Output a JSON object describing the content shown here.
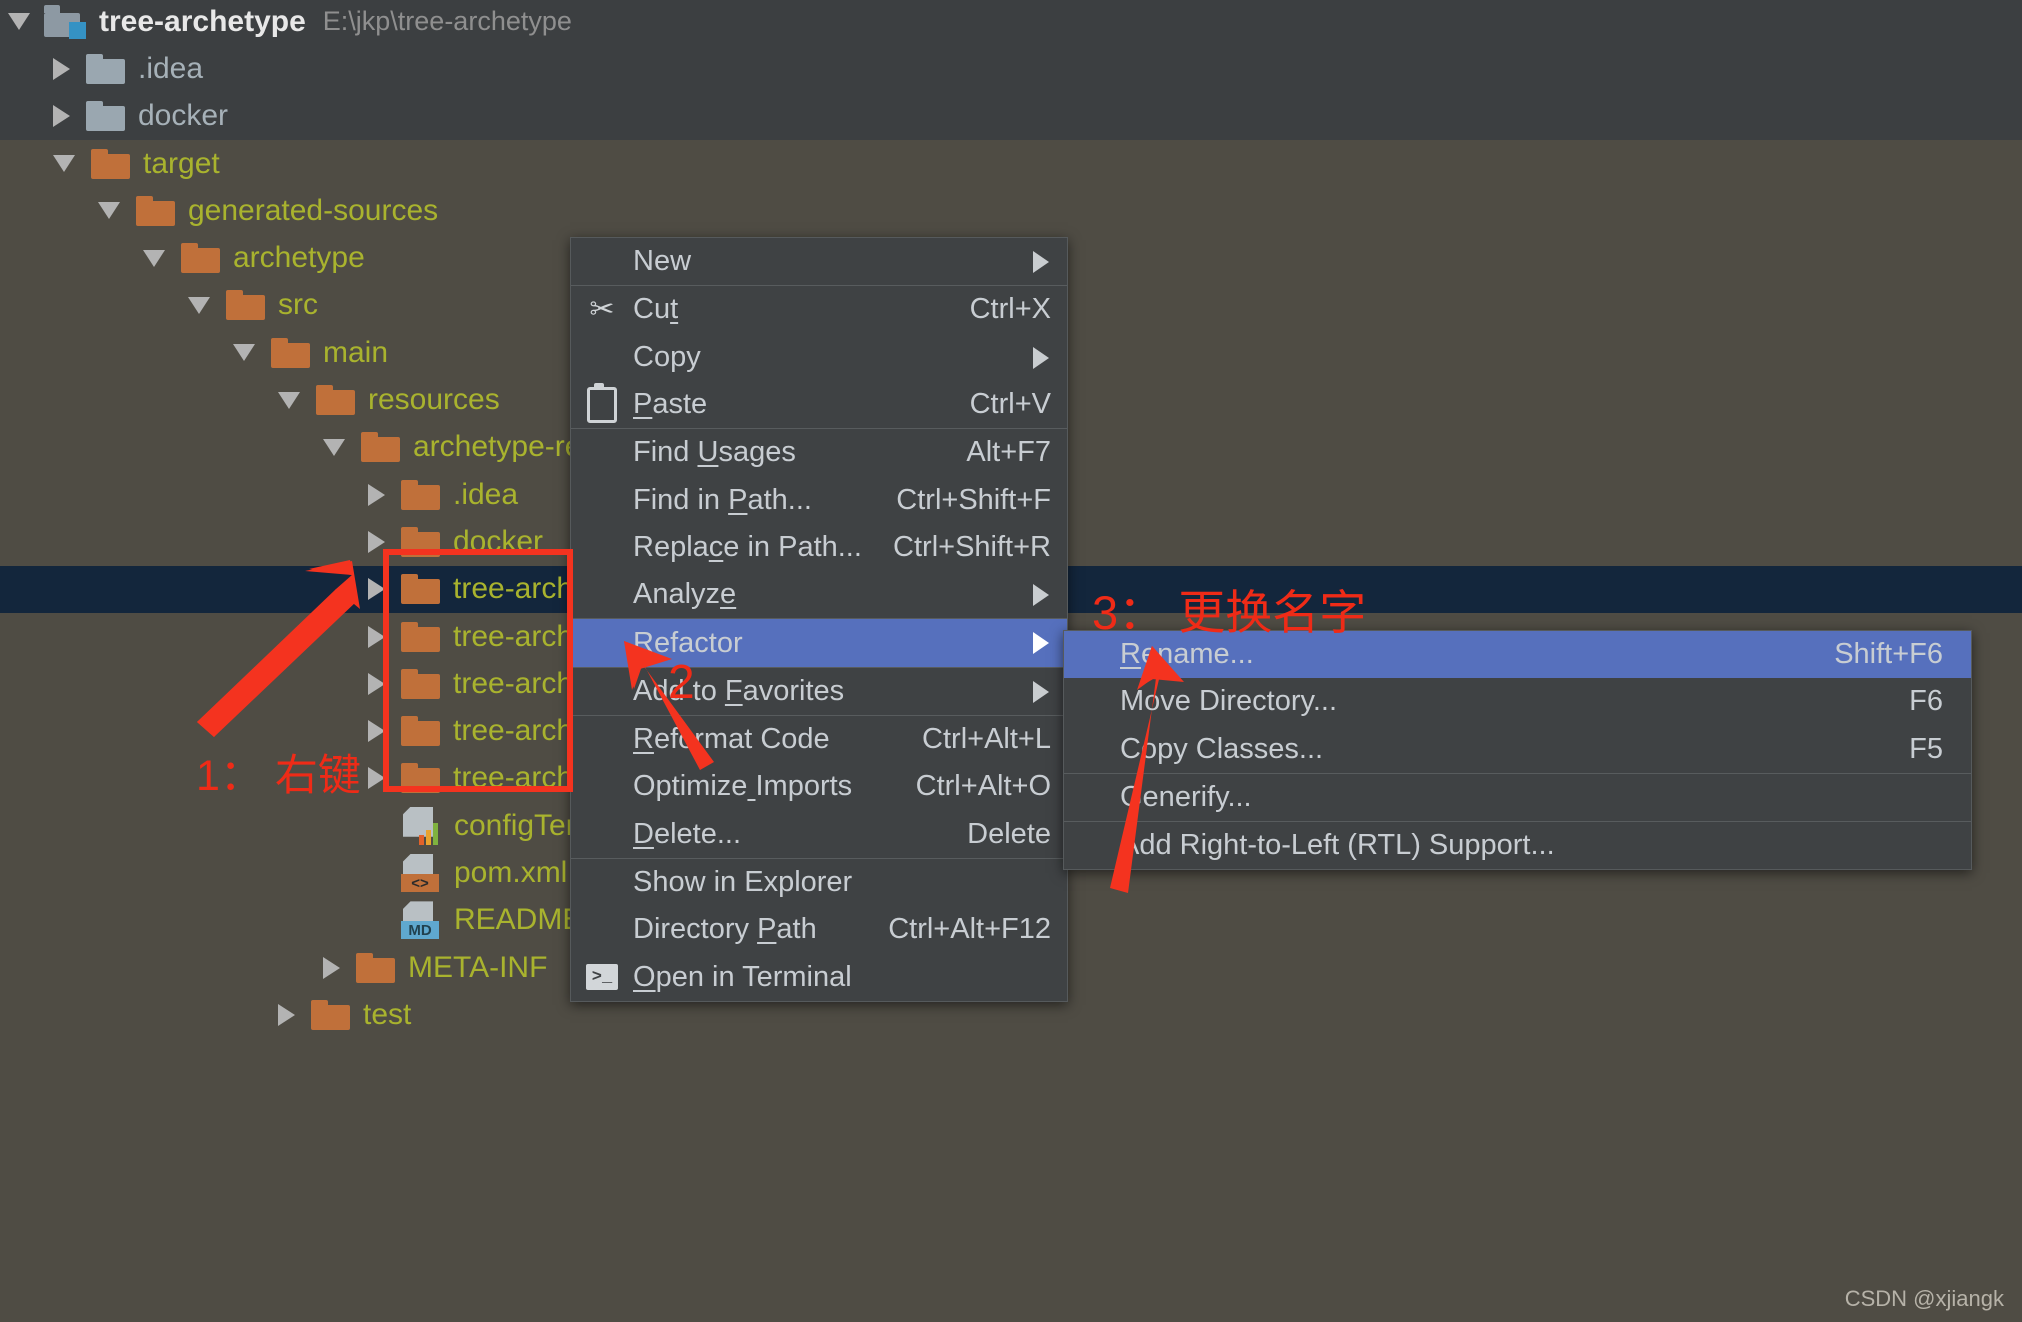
{
  "project_tree": {
    "root": {
      "name": "tree-archetype",
      "path": "E:\\jkp\\tree-archetype"
    },
    "items": [
      {
        "label": ".idea",
        "state": "collapsed",
        "kind": "folder-grey",
        "indent": 1
      },
      {
        "label": "docker",
        "state": "collapsed",
        "kind": "folder-grey",
        "indent": 1
      },
      {
        "label": "target",
        "state": "expanded",
        "kind": "folder",
        "indent": 1
      },
      {
        "label": "generated-sources",
        "state": "expanded",
        "kind": "folder",
        "indent": 2
      },
      {
        "label": "archetype",
        "state": "expanded",
        "kind": "folder",
        "indent": 3
      },
      {
        "label": "src",
        "state": "expanded",
        "kind": "folder",
        "indent": 4
      },
      {
        "label": "main",
        "state": "expanded",
        "kind": "folder",
        "indent": 5
      },
      {
        "label": "resources",
        "state": "expanded",
        "kind": "folder",
        "indent": 6
      },
      {
        "label": "archetype-reso",
        "state": "expanded",
        "kind": "folder",
        "indent": 7
      },
      {
        "label": ".idea",
        "state": "collapsed",
        "kind": "folder",
        "indent": 8
      },
      {
        "label": "docker",
        "state": "collapsed",
        "kind": "folder",
        "indent": 8
      },
      {
        "label": "tree-archety",
        "state": "collapsed",
        "kind": "folder",
        "indent": 8,
        "selected": true
      },
      {
        "label": "tree-archety",
        "state": "collapsed",
        "kind": "folder",
        "indent": 8
      },
      {
        "label": "tree-archety",
        "state": "collapsed",
        "kind": "folder",
        "indent": 8
      },
      {
        "label": "tree-archety",
        "state": "collapsed",
        "kind": "folder",
        "indent": 8
      },
      {
        "label": "tree-archety",
        "state": "collapsed",
        "kind": "folder",
        "indent": 8
      },
      {
        "label": "configTemp",
        "state": "none",
        "kind": "file-chart",
        "indent": 8
      },
      {
        "label": "pom.xml",
        "state": "none",
        "kind": "file-xml",
        "indent": 8
      },
      {
        "label": "README.m",
        "state": "none",
        "kind": "file-md",
        "indent": 8
      },
      {
        "label": "META-INF",
        "state": "collapsed",
        "kind": "folder",
        "indent": 7
      },
      {
        "label": "test",
        "state": "collapsed",
        "kind": "folder",
        "indent": 6
      }
    ]
  },
  "context_menu": {
    "items": [
      {
        "label": "New",
        "shortcut": "",
        "submenu": true,
        "icon": "",
        "sep_after": true
      },
      {
        "label": "Cut",
        "shortcut": "Ctrl+X",
        "submenu": false,
        "icon": "scissors-icon",
        "mnemonic_index": 2
      },
      {
        "label": "Copy",
        "shortcut": "",
        "submenu": true,
        "icon": ""
      },
      {
        "label": "Paste",
        "shortcut": "Ctrl+V",
        "submenu": false,
        "icon": "clipboard-icon",
        "mnemonic_index": 0,
        "sep_after": true
      },
      {
        "label": "Find Usages",
        "shortcut": "Alt+F7",
        "submenu": false,
        "icon": "",
        "mnemonic_index": 5
      },
      {
        "label": "Find in Path...",
        "shortcut": "Ctrl+Shift+F",
        "submenu": false,
        "icon": "",
        "mnemonic_index": 8
      },
      {
        "label": "Replace in Path...",
        "shortcut": "Ctrl+Shift+R",
        "submenu": false,
        "icon": "",
        "mnemonic_index": 5
      },
      {
        "label": "Analyze",
        "shortcut": "",
        "submenu": true,
        "icon": "",
        "mnemonic_index": 6,
        "sep_after": true
      },
      {
        "label": "Refactor",
        "shortcut": "",
        "submenu": true,
        "icon": "",
        "mnemonic_index": 0,
        "selected": true,
        "sep_after": true
      },
      {
        "label": "Add to Favorites",
        "shortcut": "",
        "submenu": true,
        "icon": "",
        "mnemonic_index": 7,
        "sep_after": true
      },
      {
        "label": "Reformat Code",
        "shortcut": "Ctrl+Alt+L",
        "submenu": false,
        "icon": "",
        "mnemonic_index": 0
      },
      {
        "label": "Optimize Imports",
        "shortcut": "Ctrl+Alt+O",
        "submenu": false,
        "icon": "",
        "mnemonic_index": 8
      },
      {
        "label": "Delete...",
        "shortcut": "Delete",
        "submenu": false,
        "icon": "",
        "mnemonic_index": 0,
        "sep_after": true
      },
      {
        "label": "Show in Explorer",
        "shortcut": "",
        "submenu": false,
        "icon": ""
      },
      {
        "label": "Directory Path",
        "shortcut": "Ctrl+Alt+F12",
        "submenu": false,
        "icon": "",
        "mnemonic_index": 10
      },
      {
        "label": "Open in Terminal",
        "shortcut": "",
        "submenu": false,
        "icon": "terminal-icon",
        "mnemonic_index": 0
      }
    ]
  },
  "refactor_submenu": {
    "items": [
      {
        "label": "Rename...",
        "shortcut": "Shift+F6",
        "selected": true,
        "mnemonic_index": 0
      },
      {
        "label": "Move Directory...",
        "shortcut": "F6"
      },
      {
        "label": "Copy Classes...",
        "shortcut": "F5",
        "sep_after": true
      },
      {
        "label": "Generify...",
        "shortcut": "",
        "sep_after": true
      },
      {
        "label": "Add Right-to-Left (RTL) Support...",
        "shortcut": ""
      }
    ]
  },
  "annotations": [
    {
      "id": "step1",
      "text": "1： 右键"
    },
    {
      "id": "step2",
      "text": "2"
    },
    {
      "id": "step3",
      "text": "3： 更换名字"
    }
  ],
  "watermark": {
    "text": "CSDN @xjiangk"
  },
  "colors": {
    "accent_red": "#ef2b17",
    "menu_selection": "#5670bd",
    "tree_selection": "#13263c",
    "folder": "#c0703a",
    "label": "#a9b32e"
  }
}
